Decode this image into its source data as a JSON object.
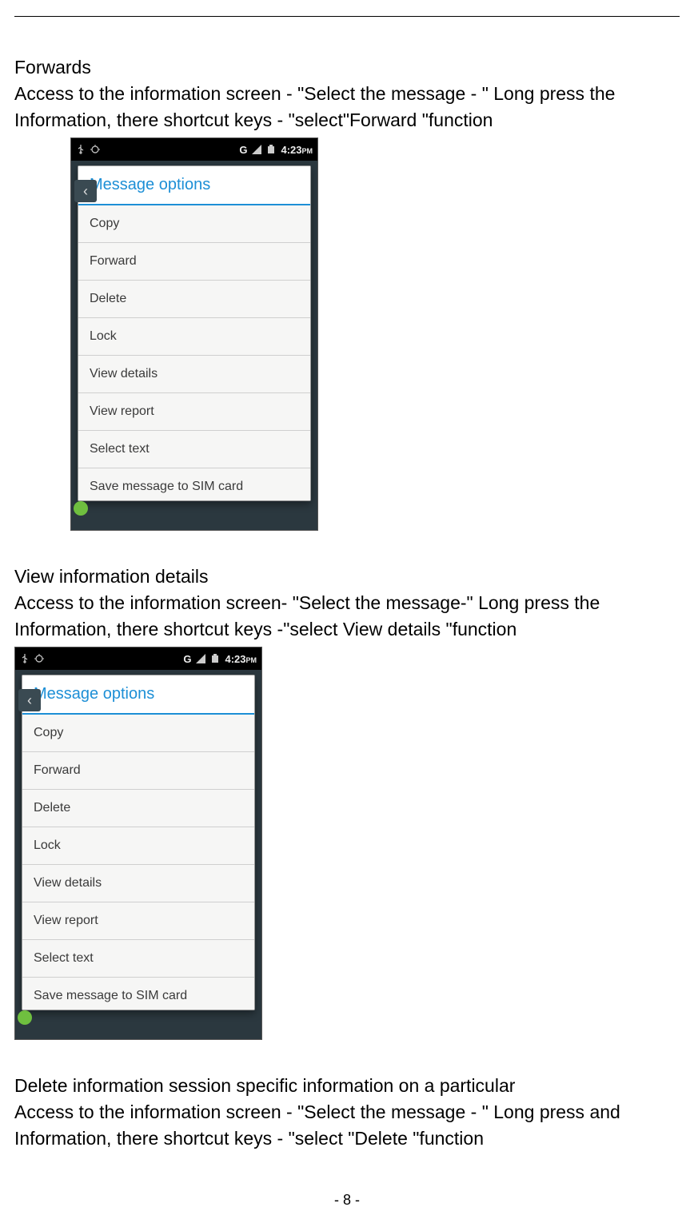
{
  "page_number": "- 8 -",
  "sections": {
    "forwards": {
      "title": "Forwards",
      "line1": "Access to the information screen - \"Select the message - \" Long press the",
      "line2": "Information, there shortcut keys - \"select\"Forward \"function"
    },
    "viewdetails": {
      "title": "View information details",
      "line1": "Access to the information screen- \"Select the message-\" Long press the",
      "line2": "Information, there shortcut keys -\"select View details \"function"
    },
    "delete": {
      "title": "Delete information session specific information on a particular",
      "line1": "Access to the information screen - \"Select the message - \" Long press and",
      "line2": "Information, there shortcut keys - \"select \"Delete \"function"
    }
  },
  "phone": {
    "statusbar": {
      "network_label": "G",
      "time": "4:23",
      "ampm": "PM"
    },
    "dialog_title": "Message options",
    "options": [
      "Copy",
      "Forward",
      "Delete",
      "Lock",
      "View details",
      "View report",
      "Select text",
      "Save message to SIM card"
    ]
  }
}
